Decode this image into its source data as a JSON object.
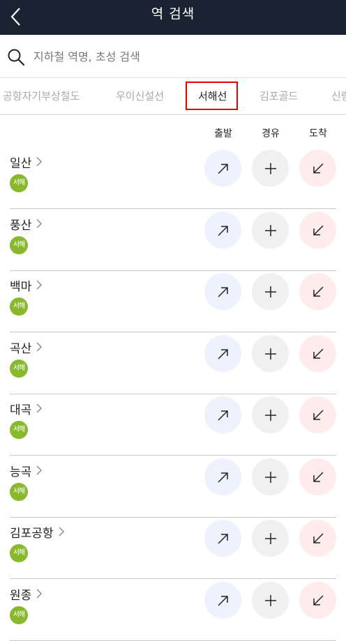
{
  "header": {
    "title": "역 검색",
    "back_icon": "chevron-left-icon"
  },
  "search": {
    "placeholder": "지하철 역명, 초성 검색",
    "value": "",
    "icon": "search-icon"
  },
  "tabs": [
    {
      "label": "공항자기부상철도",
      "active": false
    },
    {
      "label": "우이신설선",
      "active": false
    },
    {
      "label": "서해선",
      "active": true
    },
    {
      "label": "김포골드",
      "active": false
    },
    {
      "label": "신림",
      "active": false
    }
  ],
  "columns": {
    "departure": "출발",
    "via": "경유",
    "arrival": "도착"
  },
  "line_badge": {
    "label": "서해",
    "color": "#88b82c"
  },
  "stations": [
    {
      "name": "일산"
    },
    {
      "name": "풍산"
    },
    {
      "name": "백마"
    },
    {
      "name": "곡산"
    },
    {
      "name": "대곡"
    },
    {
      "name": "능곡"
    },
    {
      "name": "김포공항"
    },
    {
      "name": "원종"
    }
  ],
  "colors": {
    "header_bg": "#1b2333",
    "highlight": "#e00000",
    "departure_bg": "#eef2fd",
    "via_bg": "#f0f0f0",
    "arrival_bg": "#fdeceb"
  }
}
